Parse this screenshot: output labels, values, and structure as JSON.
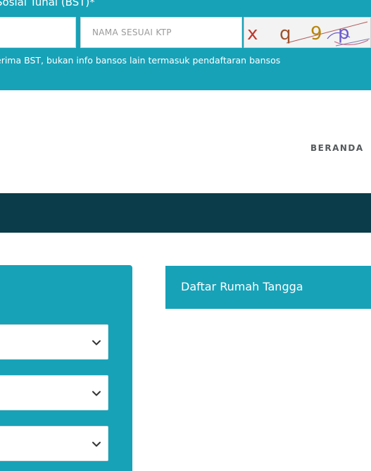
{
  "banner": {
    "title": "Sosial Tunai (BST)*",
    "name_placeholder": "NAMA SESUAI KTP",
    "captcha_text": "x q 9 p",
    "note": "erima BST, bukan info bansos lain termasuk pendaftaran bansos"
  },
  "nav": {
    "beranda_label": "BERANDA"
  },
  "filters": {
    "selects": [
      {
        "value": ""
      },
      {
        "value": ""
      },
      {
        "value": ""
      }
    ]
  },
  "household_card": {
    "title": "Daftar Rumah Tangga"
  },
  "colors": {
    "teal": "#17a2b8",
    "dark_navy": "#0b3c49",
    "white": "#ffffff"
  }
}
